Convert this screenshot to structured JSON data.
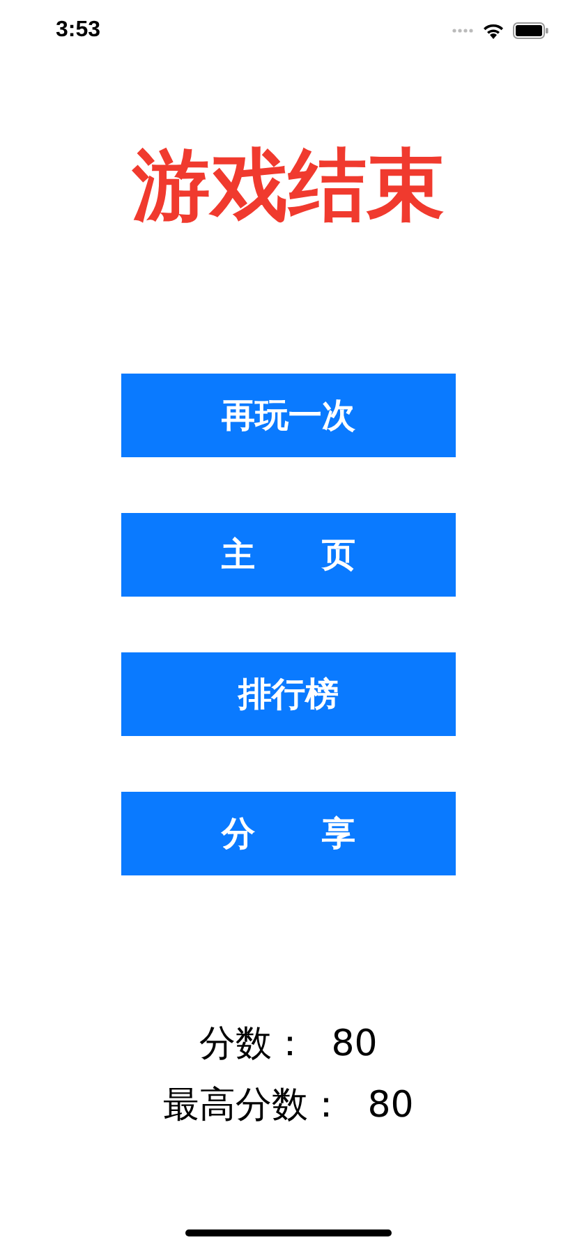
{
  "status_bar": {
    "time": "3:53"
  },
  "title": "游戏结束",
  "buttons": [
    {
      "label": "再玩一次"
    },
    {
      "label": "主　　页"
    },
    {
      "label": "排行榜"
    },
    {
      "label": "分　　享"
    }
  ],
  "scores": [
    {
      "text": "分数：  80"
    },
    {
      "text": "最高分数：  80"
    }
  ]
}
